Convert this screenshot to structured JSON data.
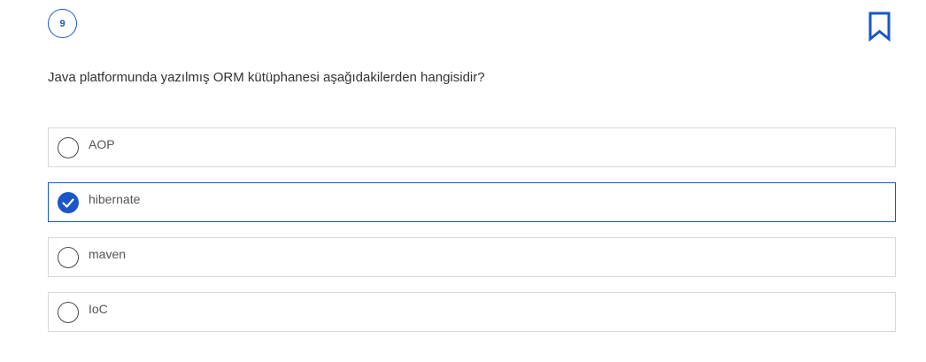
{
  "question": {
    "number": "9",
    "text": "Java platformunda yazılmış ORM kütüphanesi aşağıdakilerden hangisidir?"
  },
  "bookmark_icon": "bookmark-icon",
  "colors": {
    "accent": "#1a56c7",
    "border": "#d9d9d9",
    "text": "#333333"
  },
  "options": [
    {
      "label": "AOP",
      "selected": false
    },
    {
      "label": "hibernate",
      "selected": true
    },
    {
      "label": "maven",
      "selected": false
    },
    {
      "label": "IoC",
      "selected": false
    }
  ]
}
